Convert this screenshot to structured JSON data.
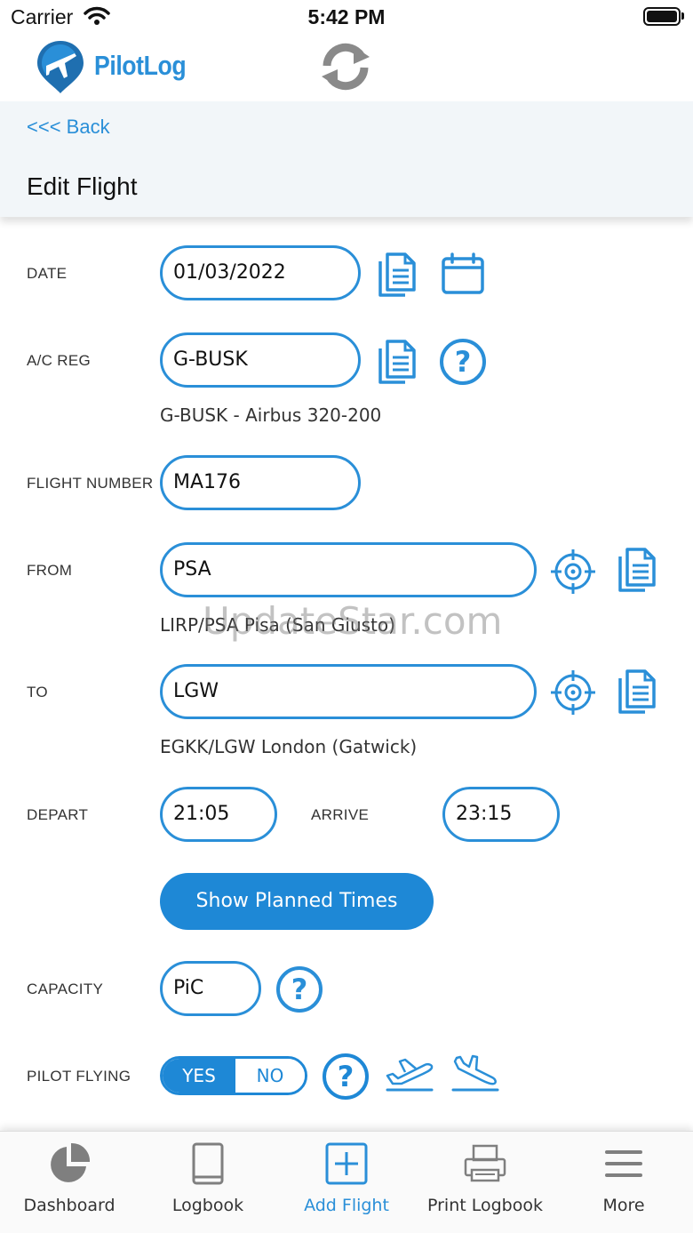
{
  "status_bar": {
    "carrier": "Carrier",
    "time": "5:42 PM"
  },
  "app": {
    "logo_text": "PilotLog"
  },
  "nav": {
    "back_label": "<<< Back",
    "page_title": "Edit Flight"
  },
  "form": {
    "date": {
      "label": "DATE",
      "value": "01/03/2022"
    },
    "ac_reg": {
      "label": "A/C REG",
      "value": "G-BUSK",
      "detail": "G-BUSK - Airbus 320-200"
    },
    "flight_number": {
      "label": "FLIGHT NUMBER",
      "value": "MA176"
    },
    "from": {
      "label": "FROM",
      "value": "PSA",
      "detail": "LIRP/PSA Pisa (San Giusto)"
    },
    "to": {
      "label": "TO",
      "value": "LGW",
      "detail": "EGKK/LGW London (Gatwick)"
    },
    "depart": {
      "label": "DEPART",
      "value": "21:05"
    },
    "arrive": {
      "label": "ARRIVE",
      "value": "23:15"
    },
    "planned_button": "Show Planned Times",
    "capacity": {
      "label": "CAPACITY",
      "value": "PiC"
    },
    "pilot_flying": {
      "label": "PILOT FLYING",
      "yes": "YES",
      "no": "NO",
      "selected": "YES"
    }
  },
  "watermark": "UpdateStar.com",
  "tabs": [
    {
      "label": "Dashboard",
      "icon": "pie-chart-icon"
    },
    {
      "label": "Logbook",
      "icon": "book-icon"
    },
    {
      "label": "Add Flight",
      "icon": "add-icon",
      "active": true
    },
    {
      "label": "Print Logbook",
      "icon": "printer-icon"
    },
    {
      "label": "More",
      "icon": "menu-icon"
    }
  ],
  "colors": {
    "accent": "#2a8fd8",
    "button": "#1e88d6",
    "subheader_bg": "#f2f6f9"
  }
}
